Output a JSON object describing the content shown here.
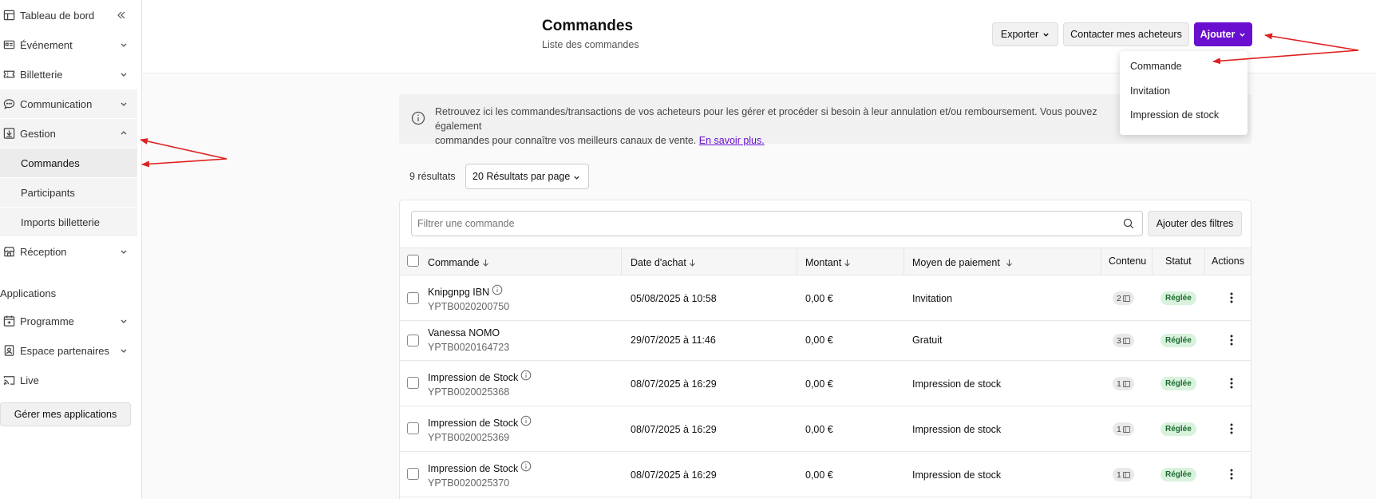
{
  "sidebar": {
    "items": [
      {
        "label": "Tableau de bord",
        "icon": "dashboard-icon"
      },
      {
        "label": "Événement",
        "icon": "event-icon"
      },
      {
        "label": "Billetterie",
        "icon": "ticket-icon"
      },
      {
        "label": "Communication",
        "icon": "chat-icon"
      },
      {
        "label": "Gestion",
        "icon": "download-box-icon"
      },
      {
        "label": "Réception",
        "icon": "store-icon"
      },
      {
        "label": "Programme",
        "icon": "calendar-icon"
      },
      {
        "label": "Espace partenaires",
        "icon": "badge-icon"
      },
      {
        "label": "Live",
        "icon": "cast-icon"
      }
    ],
    "gestion_sub": [
      {
        "label": "Commandes"
      },
      {
        "label": "Participants"
      },
      {
        "label": "Imports billetterie"
      }
    ],
    "applications_heading": "Applications",
    "manage_apps_label": "Gérer mes applications"
  },
  "header": {
    "title": "Commandes",
    "subtitle": "Liste des commandes",
    "export_label": "Exporter",
    "contact_label": "Contacter mes acheteurs",
    "add_label": "Ajouter"
  },
  "add_menu": {
    "items": [
      "Commande",
      "Invitation",
      "Impression de stock"
    ]
  },
  "info_banner": {
    "text": "Retrouvez ici les commandes/transactions de vos acheteurs pour les gérer et procéder si besoin à leur annulation et/ou remboursement. Vous pouvez également",
    "text2": "commandes pour connaître vos meilleurs canaux de vente.",
    "link": "En savoir plus."
  },
  "results": {
    "count_label": "9 résultats",
    "per_page": "20 Résultats par page"
  },
  "filters": {
    "search_placeholder": "Filtrer une commande",
    "add_filters_label": "Ajouter des filtres"
  },
  "table": {
    "columns": {
      "order": "Commande",
      "date": "Date d'achat",
      "amount": "Montant",
      "payment": "Moyen de paiement",
      "content": "Contenu",
      "status": "Statut",
      "actions": "Actions"
    },
    "rows": [
      {
        "name": "Knipgnpg IBN",
        "ref": "YPTB0020200750",
        "date": "05/08/2025 à 10:58",
        "amount": "0,00 €",
        "payment": "Invitation",
        "count": "2",
        "status": "Réglée"
      },
      {
        "name": "Vanessa NOMO",
        "ref": "YPTB0020164723",
        "date": "29/07/2025 à 11:46",
        "amount": "0,00 €",
        "payment": "Gratuit",
        "count": "3",
        "status": "Réglée"
      },
      {
        "name": "Impression de Stock",
        "ref": "YPTB0020025368",
        "date": "08/07/2025 à 16:29",
        "amount": "0,00 €",
        "payment": "Impression de stock",
        "count": "1",
        "status": "Réglée"
      },
      {
        "name": "Impression de Stock",
        "ref": "YPTB0020025369",
        "date": "08/07/2025 à 16:29",
        "amount": "0,00 €",
        "payment": "Impression de stock",
        "count": "1",
        "status": "Réglée"
      },
      {
        "name": "Impression de Stock",
        "ref": "YPTB0020025370",
        "date": "08/07/2025 à 16:29",
        "amount": "0,00 €",
        "payment": "Impression de stock",
        "count": "1",
        "status": "Réglée"
      }
    ]
  },
  "colors": {
    "accent": "#6a0fd0",
    "status_bg": "#d9f2dd",
    "status_text": "#1d6b30",
    "annotation": "#e02020"
  }
}
